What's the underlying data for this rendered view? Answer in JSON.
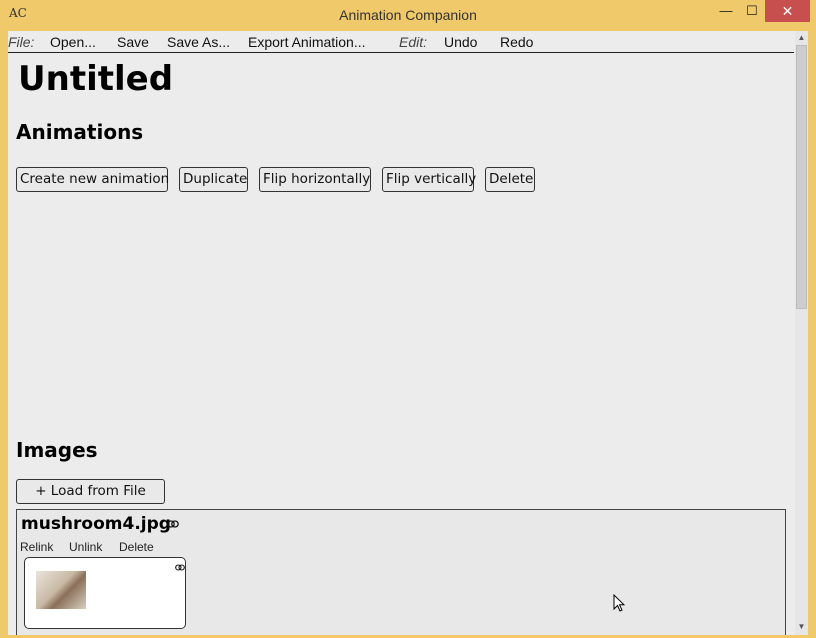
{
  "window": {
    "title": "Animation Companion",
    "icon": "app-logo-icon",
    "icon_text": "AC",
    "controls": {
      "minimize": "—",
      "maximize": "☐",
      "close": "✕"
    }
  },
  "menu": {
    "file_label": "File:",
    "file_items": [
      "Open...",
      "Save",
      "Save As...",
      "Export Animation..."
    ],
    "edit_label": "Edit:",
    "edit_items": [
      "Undo",
      "Redo"
    ]
  },
  "document": {
    "title": "Untitled"
  },
  "animations": {
    "heading": "Animations",
    "buttons": [
      "Create new animation",
      "Duplicate",
      "Flip horizontally",
      "Flip vertically",
      "Delete"
    ]
  },
  "images": {
    "heading": "Images",
    "load_button": "+ Load from File",
    "items": [
      {
        "name": "mushroom4.jpg",
        "visibility_icon": "eye-icon",
        "actions": [
          "Relink",
          "Unlink",
          "Delete"
        ]
      }
    ]
  },
  "colors": {
    "title_bar": "#f0c96a",
    "close_button": "#c7504f",
    "client_background": "#ececec"
  }
}
